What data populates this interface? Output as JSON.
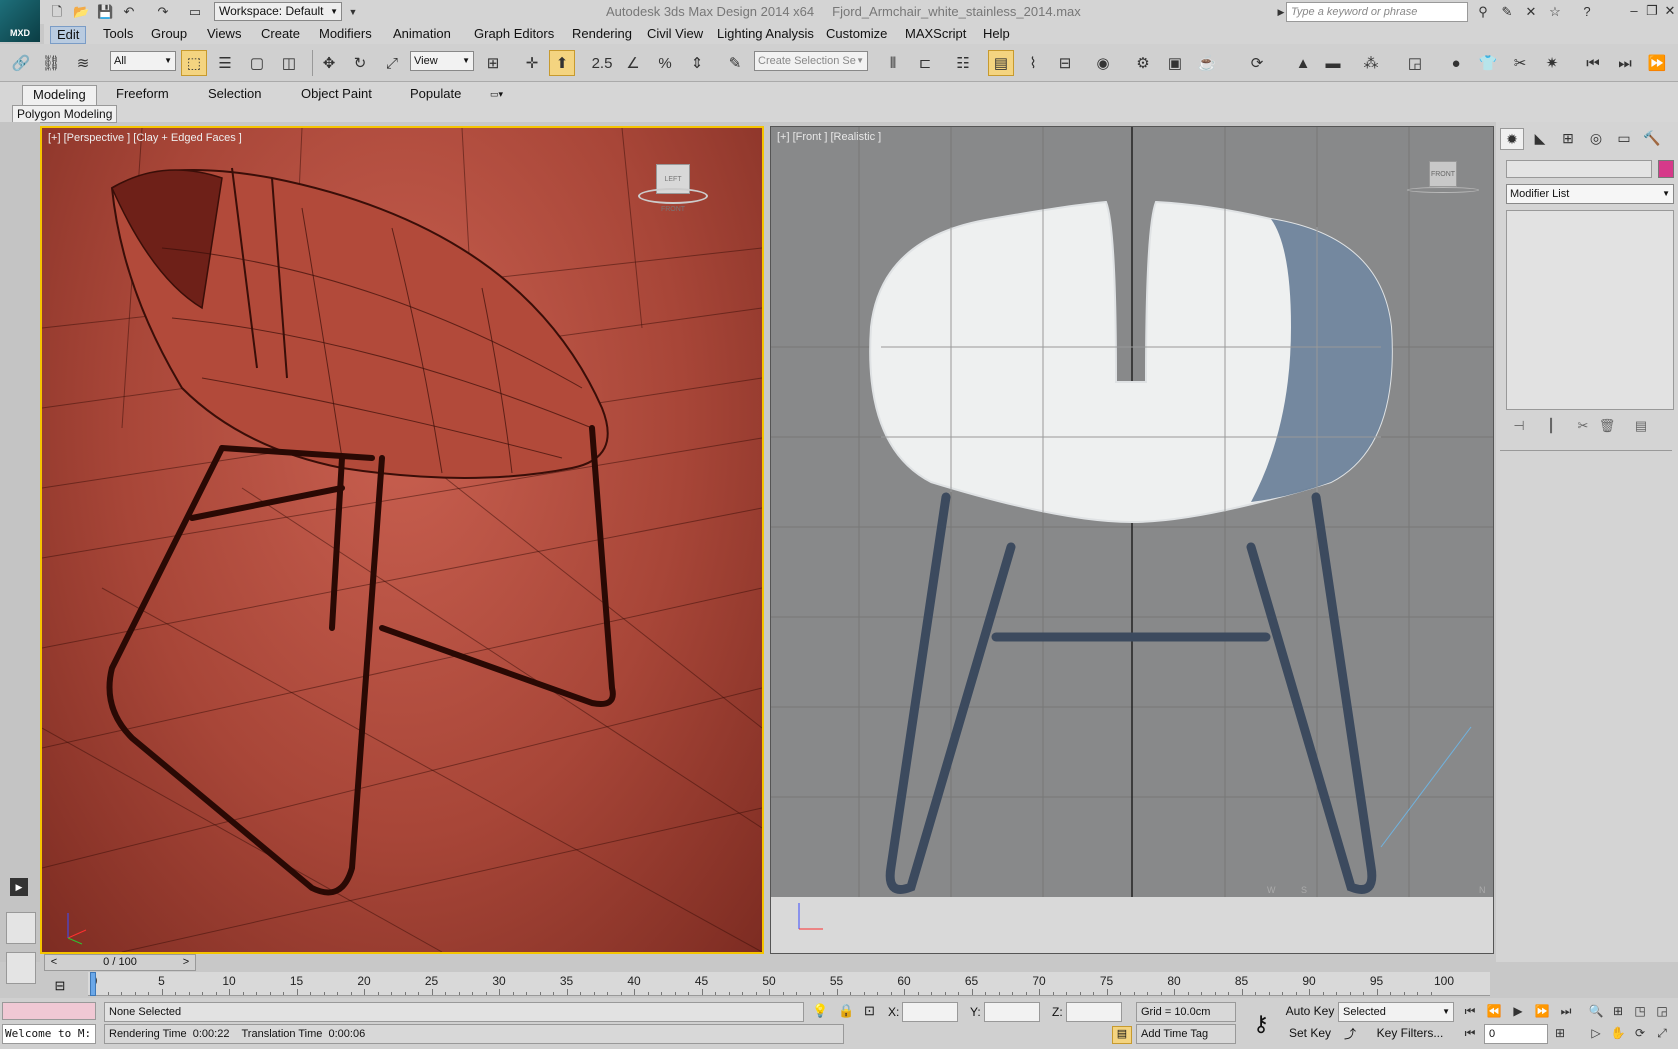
{
  "titlebar": {
    "workspace": "Workspace: Default",
    "app_title": "Autodesk 3ds Max Design 2014 x64     Fjord_Armchair_white_stainless_2014.max",
    "search_placeholder": "Type a keyword or phrase",
    "logo_text": "MXD"
  },
  "menu": [
    "Edit",
    "Tools",
    "Group",
    "Views",
    "Create",
    "Modifiers",
    "Animation",
    "Graph Editors",
    "Rendering",
    "Civil View",
    "Lighting Analysis",
    "Customize",
    "MAXScript",
    "Help"
  ],
  "toolbar": {
    "filter_value": "All",
    "ref_coord_value": "View",
    "selection_set_placeholder": "Create Selection Se"
  },
  "ribbon": {
    "tabs": [
      "Modeling",
      "Freeform",
      "Selection",
      "Object Paint",
      "Populate"
    ],
    "panel_label": "Polygon Modeling"
  },
  "viewports": {
    "perspective_label": "[+] [Perspective ] [Clay + Edged Faces ]",
    "front_label": "[+] [Front ] [Realistic ]",
    "viewcube_front": "FRONT",
    "viewcube_persp": "LEFT FRONT",
    "compass_w": "W",
    "compass_s": "S",
    "compass_n": "N"
  },
  "command_panel": {
    "modifier_list": "Modifier List",
    "object_color": "#d63a8a"
  },
  "timeline": {
    "time_slider": "0 / 100",
    "ticks": [
      0,
      5,
      10,
      15,
      20,
      25,
      30,
      35,
      40,
      45,
      50,
      55,
      60,
      65,
      70,
      75,
      80,
      85,
      90,
      95,
      100
    ]
  },
  "status": {
    "maxscript_listener": "Welcome to M:",
    "selection": "None Selected",
    "prompt": "Rendering Time  0:00:22    Translation Time  0:00:06",
    "x_label": "X:",
    "y_label": "Y:",
    "z_label": "Z:",
    "grid": "Grid = 10.0cm",
    "add_time_tag": "Add Time Tag",
    "auto_key": "Auto Key",
    "set_key": "Set Key",
    "key_mode": "Selected",
    "key_filters": "Key Filters...",
    "current_frame": "0"
  },
  "colors": {
    "active_viewport_border": "#f5c400",
    "clay_viewport": "#a84638",
    "front_viewport": "#88898a"
  }
}
